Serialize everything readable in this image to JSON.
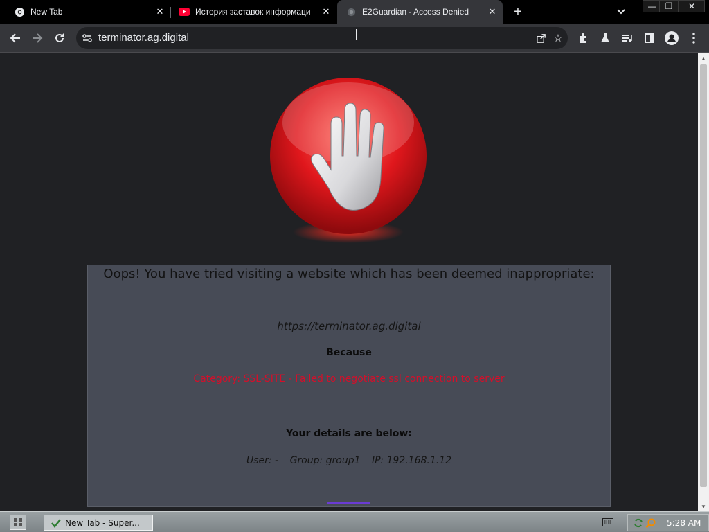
{
  "tabs": [
    {
      "title": "New Tab",
      "icon": "chrome-icon",
      "active": false
    },
    {
      "title": "История заставок информаци",
      "icon": "youtube-icon",
      "active": false
    },
    {
      "title": "E2Guardian - Access Denied",
      "icon": "globe-icon",
      "active": true
    }
  ],
  "toolbar": {
    "url": "terminator.ag.digital"
  },
  "page": {
    "headline": "Oops! You have tried visiting a website which has been deemed inappropriate:",
    "blocked_url": "https://terminator.ag.digital",
    "because_label": "Because",
    "reason": "Category: SSL-SITE - Failed to negotiate ssl connection to server",
    "details_heading": "Your details are below:",
    "user": "User: -",
    "group": "Group: group1",
    "ip": "IP: 192.168.1.12"
  },
  "taskbar": {
    "task_item": "New Tab - Super...",
    "clock": "5:28 AM"
  },
  "colors": {
    "reason_text": "#d40f2a",
    "stop_sign_red": "#e0171c",
    "message_box_bg": "#474b56"
  }
}
